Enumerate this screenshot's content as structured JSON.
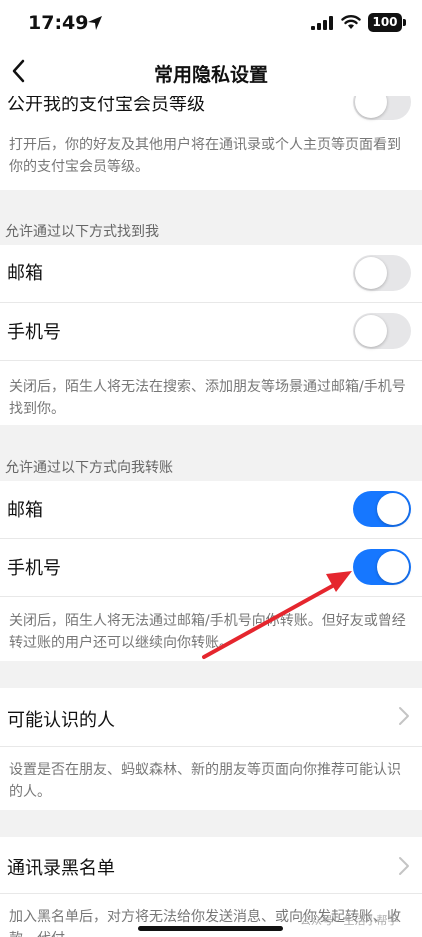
{
  "status": {
    "time": "17:49",
    "battery": "100"
  },
  "nav": {
    "title": "常用隐私设置"
  },
  "top": {
    "partial_label": "公开我的支付宝会员等级",
    "desc": "打开后，你的好友及其他用户将在通讯录或个人主页等页面看到你的支付宝会员等级。",
    "toggle": "off"
  },
  "find_me": {
    "header": "允许通过以下方式找到我",
    "rows": [
      {
        "label": "邮箱",
        "toggle": "off"
      },
      {
        "label": "手机号",
        "toggle": "off"
      }
    ],
    "desc": "关闭后，陌生人将无法在搜索、添加朋友等场景通过邮箱/手机号找到你。"
  },
  "transfer": {
    "header": "允许通过以下方式向我转账",
    "rows": [
      {
        "label": "邮箱",
        "toggle": "on"
      },
      {
        "label": "手机号",
        "toggle": "on"
      }
    ],
    "desc": "关闭后，陌生人将无法通过邮箱/手机号向你转账。但好友或曾经转过账的用户还可以继续向你转账。"
  },
  "people": {
    "label": "可能认识的人",
    "desc": "设置是否在朋友、蚂蚁森林、新的朋友等页面向你推荐可能认识的人。"
  },
  "blacklist": {
    "label": "通讯录黑名单",
    "desc": "加入黑名单后，对方将无法给你发送消息、或向你发起转账、收款、代付"
  },
  "watermark": {
    "text": "公众号 · 生活小帮手"
  },
  "colors": {
    "accent": "#1677ff",
    "arrow": "#e5262e"
  }
}
